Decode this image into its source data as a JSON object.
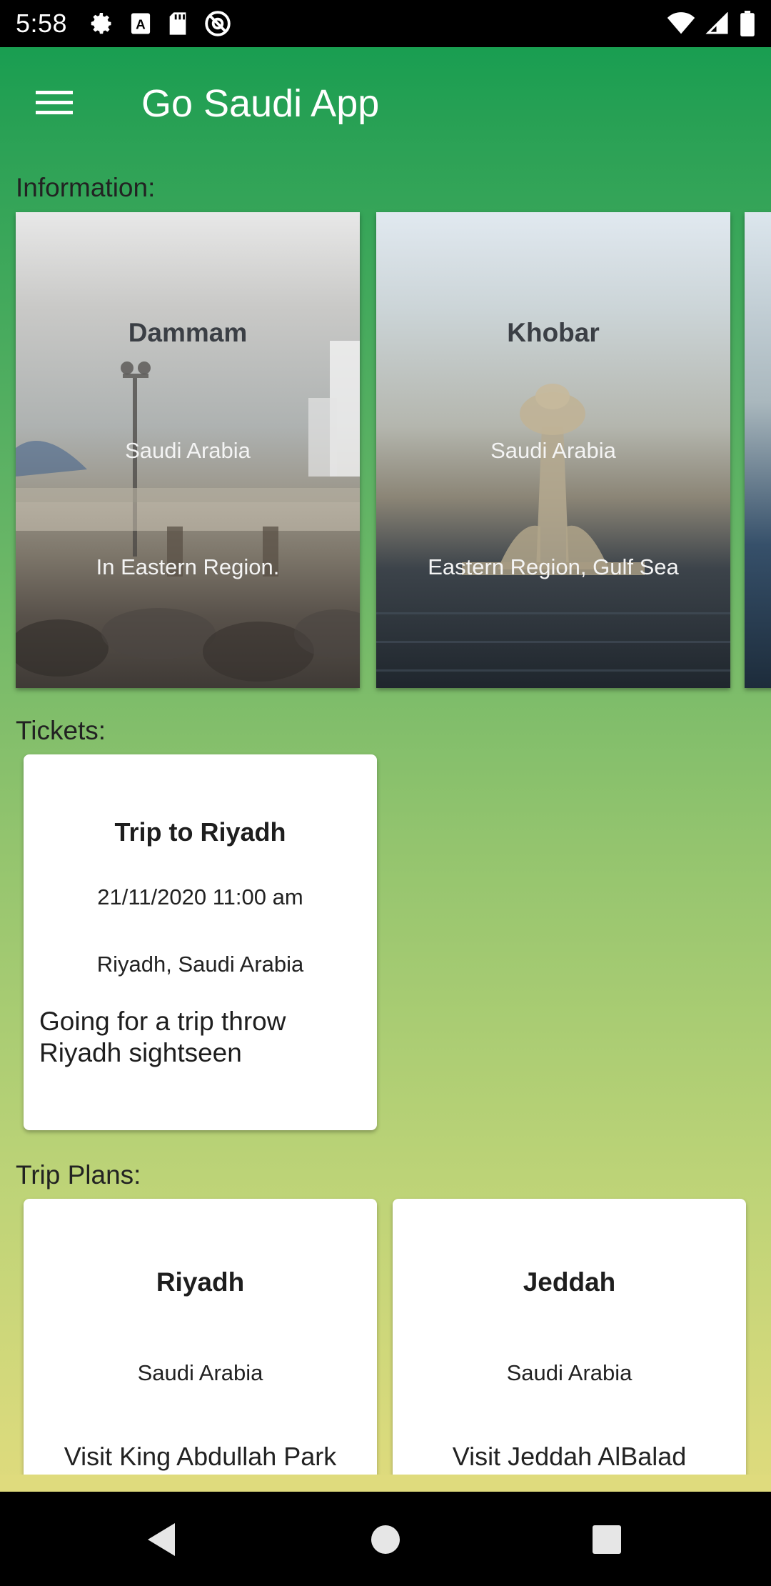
{
  "status_bar": {
    "time": "5:58",
    "left_icons": [
      "settings-icon",
      "a-box-icon",
      "sd-card-icon",
      "at-sign-icon"
    ],
    "right_icons": [
      "wifi-icon",
      "signal-icon",
      "battery-icon"
    ]
  },
  "app_bar": {
    "title": "Go Saudi App",
    "menu_icon": "hamburger-menu-icon"
  },
  "sections": {
    "information_label": "Information:",
    "tickets_label": "Tickets:",
    "trip_plans_label": "Trip Plans:"
  },
  "information_cards": [
    {
      "title": "Dammam",
      "subtitle": "Saudi Arabia",
      "description": "In Eastern Region."
    },
    {
      "title": "Khobar",
      "subtitle": "Saudi Arabia",
      "description": "Eastern Region, Gulf Sea"
    }
  ],
  "tickets": [
    {
      "title": "Trip to Riyadh",
      "datetime": "21/11/2020 11:00 am",
      "location": "Riyadh, Saudi Arabia",
      "description": "Going for a trip throw Riyadh sightseen"
    }
  ],
  "trip_plans": [
    {
      "title": "Riyadh",
      "subtitle": "Saudi Arabia",
      "description": "Visit King Abdullah Park"
    },
    {
      "title": "Jeddah",
      "subtitle": "Saudi Arabia",
      "description": "Visit Jeddah AlBalad"
    }
  ],
  "nav_bar": {
    "icons": [
      "back-icon",
      "home-icon",
      "recents-icon"
    ]
  },
  "colors": {
    "app_bar_green": "#199e51",
    "gradient_bottom": "#dfdb7d",
    "card_background": "#ffffff"
  }
}
